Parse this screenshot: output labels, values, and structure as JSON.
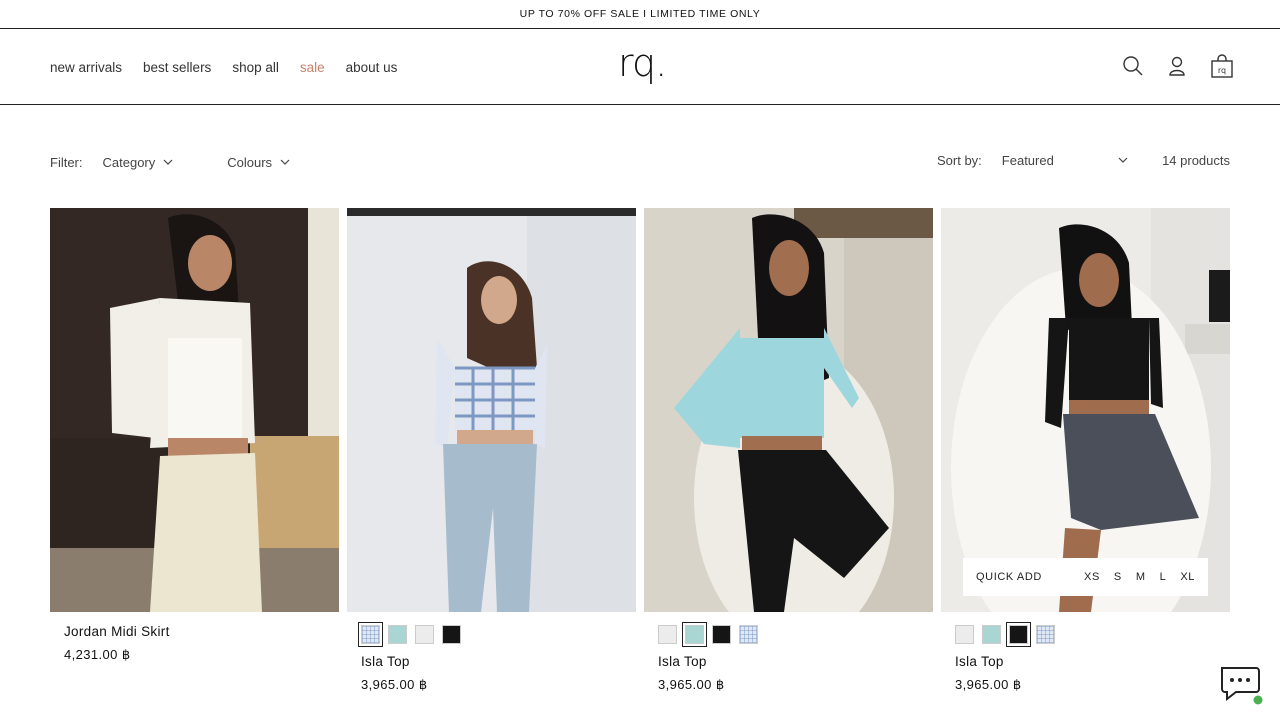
{
  "announcement": "UP TO 70% OFF SALE I LIMITED TIME ONLY",
  "nav": {
    "items": [
      "new arrivals",
      "best sellers",
      "shop all",
      "sale",
      "about us"
    ]
  },
  "logo": "rq.",
  "filter": {
    "label": "Filter:",
    "options": [
      "Category",
      "Colours"
    ],
    "sort_label": "Sort by:",
    "sort_value": "Featured",
    "count": "14 products"
  },
  "products": [
    {
      "title": "Jordan Midi Skirt",
      "price": "4,231.00 ฿"
    },
    {
      "title": "Isla Top",
      "price": "3,965.00 ฿"
    },
    {
      "title": "Isla Top",
      "price": "3,965.00 ฿"
    },
    {
      "title": "Isla Top",
      "price": "3,965.00 ฿"
    }
  ],
  "quick_add": {
    "label": "QUICK ADD",
    "sizes": [
      "XS",
      "S",
      "M",
      "L",
      "XL"
    ]
  },
  "colors": {
    "sale": "#c9826b",
    "swatch_gingham": "#dfe8f5",
    "swatch_aqua": "#a9d6d3",
    "swatch_white": "#ececec",
    "swatch_black": "#151515",
    "chat_online": "#4cb050"
  }
}
